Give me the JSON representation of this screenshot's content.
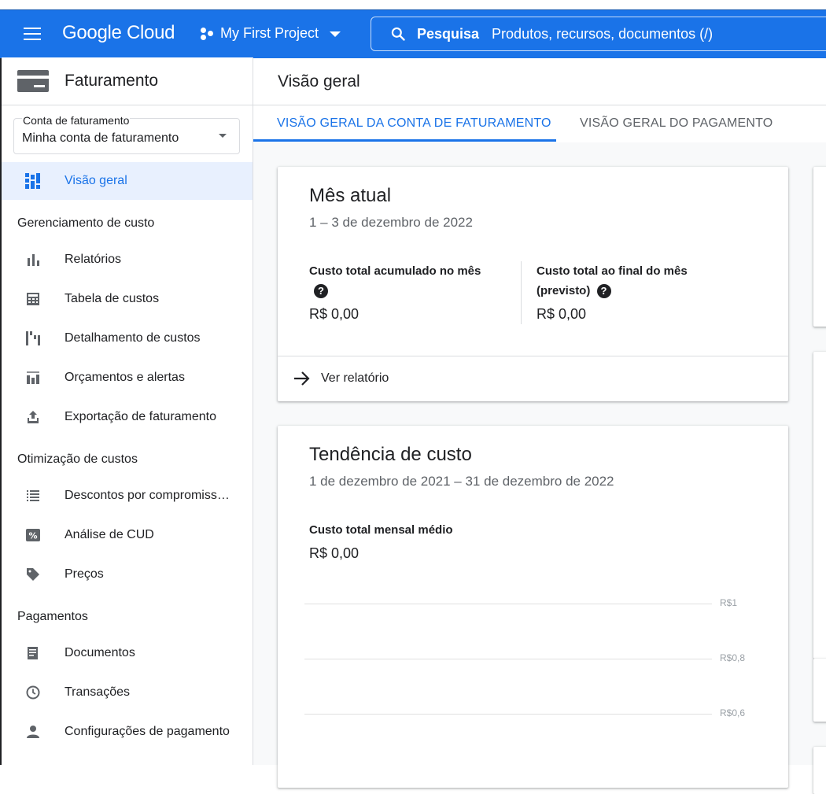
{
  "header": {
    "logo": "Google Cloud",
    "project": "My First Project",
    "search_label": "Pesquisa",
    "search_placeholder": "Produtos, recursos, documentos (/)"
  },
  "sidebar": {
    "title": "Faturamento",
    "account_label": "Conta de faturamento",
    "account_value": "Minha conta de faturamento",
    "overview": "Visão geral",
    "sections": {
      "cost_mgmt": "Gerenciamento de custo",
      "cost_opt": "Otimização de custos",
      "payments": "Pagamentos"
    },
    "items": {
      "reports": "Relatórios",
      "cost_table": "Tabela de custos",
      "cost_breakdown": "Detalhamento de custos",
      "budgets": "Orçamentos e alertas",
      "export": "Exportação de faturamento",
      "commitments": "Descontos por compromiss…",
      "cud": "Análise de CUD",
      "pricing": "Preços",
      "documents": "Documentos",
      "transactions": "Transações",
      "payment_settings": "Configurações de pagamento"
    }
  },
  "main": {
    "title": "Visão geral",
    "tabs": [
      "VISÃO GERAL DA CONTA DE FATURAMENTO",
      "VISÃO GERAL DO PAGAMENTO"
    ],
    "current_month": {
      "title": "Mês atual",
      "date_range": "1 – 3 de dezembro de 2022",
      "accrued_label": "Custo total acumulado no mês",
      "accrued_value": "R$ 0,00",
      "forecast_label_1": "Custo total ao final do mês",
      "forecast_label_2": "(previsto)",
      "forecast_value": "R$ 0,00",
      "report_link": "Ver relatório"
    },
    "trend": {
      "title": "Tendência de custo",
      "date_range": "1 de dezembro de 2021 – 31 de dezembro de 2022",
      "avg_label": "Custo total mensal médio",
      "avg_value": "R$ 0,00",
      "y_ticks": [
        "R$1",
        "R$0,8",
        "R$0,6"
      ]
    }
  }
}
